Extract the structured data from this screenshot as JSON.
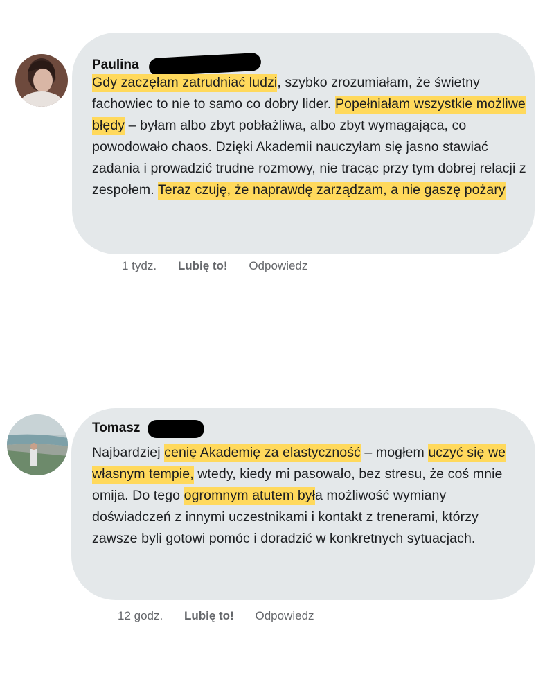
{
  "comments": [
    {
      "author": "Paulina",
      "segments": [
        {
          "text": "Gdy zaczęłam zatrudniać ludzi",
          "highlight": true
        },
        {
          "text": ", szybko zrozumiałam, że świetny fachowiec to nie to samo co dobry lider. ",
          "highlight": false
        },
        {
          "text": "Popełniałam wszystkie możliwe błędy",
          "highlight": true
        },
        {
          "text": " – byłam albo zbyt pobłażliwa, albo zbyt wymagająca, co powodowało chaos. Dzięki Akademii nauczyłam się jasno stawiać zadania i prowadzić trudne rozmowy, nie tracąc przy tym dobrej relacji z zespołem. ",
          "highlight": false
        },
        {
          "text": "Teraz czuję, że naprawdę zarządzam, a nie gaszę pożary ",
          "highlight": true
        }
      ],
      "time": "1 tydz.",
      "like_label": "Lubię to!",
      "reply_label": "Odpowiedz",
      "highlight_color": "#ffd95c"
    },
    {
      "author": "Tomasz",
      "segments": [
        {
          "text": "Najbardziej ",
          "highlight": false
        },
        {
          "text": "cenię Akademię za elastyczność",
          "highlight": true
        },
        {
          "text": " – mogłem ",
          "highlight": false
        },
        {
          "text": "uczyć się we własnym tempie,",
          "highlight": true
        },
        {
          "text": " wtedy, kiedy mi pasowało, bez stresu, że coś mnie omija. Do tego ",
          "highlight": false
        },
        {
          "text": "ogromnym atutem był",
          "highlight": true
        },
        {
          "text": "a możliwość wymiany doświadczeń z innymi uczestnikami i kontakt z trenerami, którzy zawsze byli gotowi pomóc i doradzić w konkretnych sytuacjach.",
          "highlight": false
        }
      ],
      "time": "12 godz.",
      "like_label": "Lubię to!",
      "reply_label": "Odpowiedz",
      "highlight_color": "#ffd95c"
    }
  ],
  "colors": {
    "bubble": "#e4e8ea",
    "text": "#1c1e21",
    "meta": "#65676b",
    "redaction": "#000000"
  }
}
